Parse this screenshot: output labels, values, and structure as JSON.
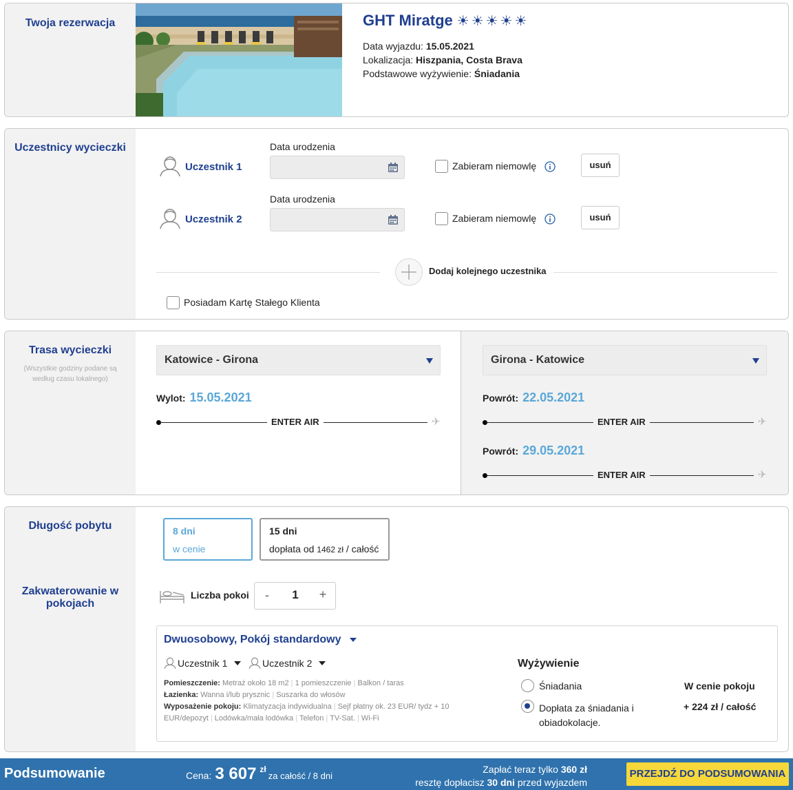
{
  "reservation": {
    "section_title": "Twoja rezerwacja",
    "hotel_name": "GHT Miratge",
    "stars": "☀☀☀☀☀",
    "departure_label": "Data wyjazdu:",
    "departure_value": "15.05.2021",
    "location_label": "Lokalizacja:",
    "location_value": "Hiszpania, Costa Brava",
    "board_label": "Podstawowe wyżywienie:",
    "board_value": "Śniadania"
  },
  "participants": {
    "section_title": "Uczestnicy wycieczki",
    "dob_label": "Data urodzenia",
    "infant_label": "Zabieram niemowlę",
    "remove_label": "usuń",
    "items": [
      {
        "name": "Uczestnik 1"
      },
      {
        "name": "Uczestnik 2"
      }
    ],
    "add_label": "Dodaj kolejnego uczestnika",
    "loyalty_label": "Posiadam Kartę Stałego Klienta"
  },
  "route": {
    "section_title": "Trasa wycieczki",
    "note": "(Wszystkie godziny podane są według czasu lokalnego)",
    "outbound": {
      "select": "Katowice - Girona",
      "label": "Wylot:",
      "date": "15.05.2021",
      "airline": "ENTER AIR"
    },
    "return": {
      "select": "Girona - Katowice",
      "label1": "Powrót:",
      "date1": "22.05.2021",
      "airline1": "ENTER AIR",
      "label2": "Powrót:",
      "date2": "29.05.2021",
      "airline2": "ENTER AIR"
    }
  },
  "stay": {
    "section_title": "Długość pobytu",
    "opt1_days": "8 dni",
    "opt1_sub": "w cenie",
    "opt2_days": "15 dni",
    "opt2_sub_prefix": "dopłata od",
    "opt2_amount": "1462 zł",
    "opt2_sub_suffix": "/ całość"
  },
  "rooms": {
    "section_title": "Zakwaterowanie w pokojach",
    "count_label": "Liczba pokoi",
    "minus": "-",
    "count": "1",
    "plus": "+",
    "room_type": "Dwuosobowy, Pokój standardowy",
    "guest1": "Uczestnik 1",
    "guest2": "Uczestnik 2",
    "room_label": "Pomieszczenie:",
    "room_items": [
      "Metraż około 18 m2",
      "1 pomieszczenie",
      "Balkon / taras"
    ],
    "bath_label": "Łazienka:",
    "bath_items": [
      "Wanna i/lub prysznic",
      "Suszarka do włosów"
    ],
    "equip_label": "Wyposażenie pokoju:",
    "equip_items": [
      "Klimatyzacja indywidualna",
      "Sejf płatny ok. 23 EUR/ tydz + 10 EUR/depozyt",
      "Lodówka/mała lodówka",
      "Telefon",
      "TV-Sat.",
      "Wi-Fi"
    ],
    "board_title": "Wyżywienie",
    "board_opt1": "Śniadania",
    "board_opt1_price": "W cenie pokoju",
    "board_opt2": "Dopłata za śniadania i obiadokolacje.",
    "board_opt2_price": "+ 224 zł / całość"
  },
  "summary": {
    "title": "Podsumowanie",
    "price_label": "Cena:",
    "price_value": "3 607",
    "currency": "zł",
    "price_suffix": "za całość / 8 dni",
    "pay_now_prefix": "Zapłać teraz tylko",
    "pay_now_value": "360 zł",
    "rest_prefix": "resztę dopłacisz",
    "rest_value": "30 dni",
    "rest_suffix": "przed wyjazdem",
    "cta": "PRZEJDŹ DO PODSUMOWANIA"
  },
  "colors": {
    "accent": "#1f3f8f",
    "date_blue": "#5aa7d8",
    "summary_bar": "#2f72ad",
    "cta_yellow": "#f7d83a"
  }
}
